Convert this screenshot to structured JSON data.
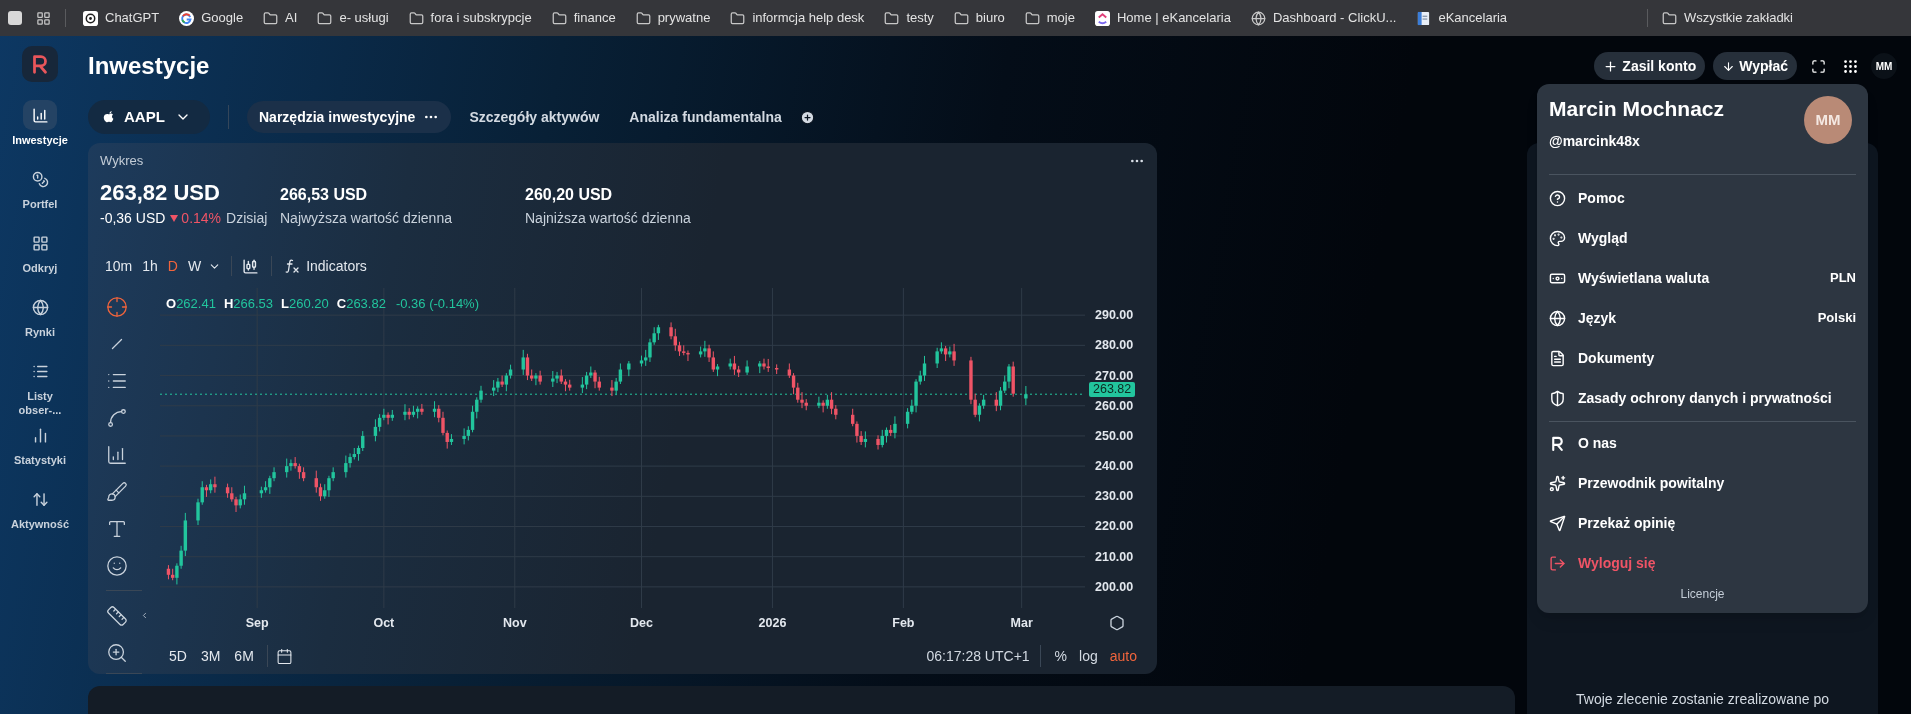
{
  "bookmarks_bar": {
    "items": [
      {
        "kind": "chatgpt",
        "label": "ChatGPT"
      },
      {
        "kind": "google",
        "label": "Google"
      },
      {
        "kind": "folder",
        "label": "AI"
      },
      {
        "kind": "folder",
        "label": "e- usługi"
      },
      {
        "kind": "folder",
        "label": "fora i subskrypcje"
      },
      {
        "kind": "folder",
        "label": "finance"
      },
      {
        "kind": "folder",
        "label": "prywatne"
      },
      {
        "kind": "folder",
        "label": "informcja help desk"
      },
      {
        "kind": "folder",
        "label": "testy"
      },
      {
        "kind": "folder",
        "label": "biuro"
      },
      {
        "kind": "folder",
        "label": "moje"
      },
      {
        "kind": "clickup",
        "label": "Home | eKancelaria"
      },
      {
        "kind": "globe",
        "label": "Dashboard - ClickU..."
      },
      {
        "kind": "document",
        "label": "eKancelaria"
      }
    ],
    "all_bookmarks": "Wszystkie zakładki"
  },
  "sidebar": {
    "items": [
      {
        "label": "Inwestycje",
        "selected": true
      },
      {
        "label": "Portfel",
        "selected": false
      },
      {
        "label": "Odkryj",
        "selected": false
      },
      {
        "label": "Rynki",
        "selected": false
      },
      {
        "label": "Listy obser-...",
        "selected": false
      },
      {
        "label": "Statystyki",
        "selected": false
      },
      {
        "label": "Aktywność",
        "selected": false
      }
    ]
  },
  "header": {
    "title": "Inwestycje",
    "buttons": [
      {
        "kind": "deposit",
        "label": "Zasil konto"
      },
      {
        "kind": "withdraw",
        "label": "Wypłać"
      }
    ],
    "avatar": "MM"
  },
  "tabs": {
    "symbol": "AAPL",
    "items": [
      {
        "label": "Narzędzia inwestycyjne",
        "selected": true
      },
      {
        "label": "Szczegóły aktywów",
        "selected": false
      },
      {
        "label": "Analiza fundamentalna",
        "selected": false
      }
    ]
  },
  "chart_card": {
    "title": "Wykres",
    "price": "263,82 USD",
    "change": "-0,36 USD",
    "change_percent": "0.14%",
    "period": "Dzisiaj",
    "stats": [
      {
        "value": "266,53 USD",
        "label": "Najwyższa wartość dzienna"
      },
      {
        "value": "260,20 USD",
        "label": "Najniższa wartość dzienna"
      }
    ],
    "timeframes": [
      {
        "label": "10m",
        "selected": false
      },
      {
        "label": "1h",
        "selected": false
      },
      {
        "label": "D",
        "selected": true
      },
      {
        "label": "W",
        "selected": false
      }
    ],
    "indicators": "Indicators",
    "legend": [
      {
        "key": "O",
        "value": "262.41"
      },
      {
        "key": "H",
        "value": "266.53"
      },
      {
        "key": "L",
        "value": "260.20"
      },
      {
        "key": "C",
        "value": "263.82"
      }
    ],
    "legend_change": "-0.36 (-0.14%)",
    "chart_data": {
      "type": "candlestick",
      "grid": true,
      "ref_lines": [
        {
          "axis": "y",
          "value": 263.82,
          "label": "263.82",
          "color": "#22c59d"
        }
      ],
      "x": [
        "2025-08-11",
        "2025-08-12",
        "2025-08-13",
        "2025-08-14",
        "2025-08-15",
        "2025-08-18",
        "2025-08-19",
        "2025-08-20",
        "2025-08-21",
        "2025-08-22",
        "2025-08-25",
        "2025-08-26",
        "2025-08-27",
        "2025-08-28",
        "2025-08-29",
        "2025-09-02",
        "2025-09-03",
        "2025-09-04",
        "2025-09-05",
        "2025-09-08",
        "2025-09-09",
        "2025-09-10",
        "2025-09-11",
        "2025-09-12",
        "2025-09-15",
        "2025-09-16",
        "2025-09-17",
        "2025-09-18",
        "2025-09-19",
        "2025-09-22",
        "2025-09-23",
        "2025-09-24",
        "2025-09-25",
        "2025-09-26",
        "2025-09-29",
        "2025-09-30",
        "2025-10-01",
        "2025-10-02",
        "2025-10-03",
        "2025-10-06",
        "2025-10-07",
        "2025-10-08",
        "2025-10-09",
        "2025-10-10",
        "2025-10-13",
        "2025-10-14",
        "2025-10-15",
        "2025-10-16",
        "2025-10-17",
        "2025-10-20",
        "2025-10-21",
        "2025-10-22",
        "2025-10-23",
        "2025-10-24",
        "2025-10-27",
        "2025-10-28",
        "2025-10-29",
        "2025-10-30",
        "2025-10-31",
        "2025-11-03",
        "2025-11-04",
        "2025-11-05",
        "2025-11-06",
        "2025-11-07",
        "2025-11-10",
        "2025-11-11",
        "2025-11-12",
        "2025-11-13",
        "2025-11-14",
        "2025-11-17",
        "2025-11-18",
        "2025-11-19",
        "2025-11-20",
        "2025-11-21",
        "2025-11-24",
        "2025-11-25",
        "2025-11-26",
        "2025-11-28",
        "2025-12-01",
        "2025-12-02",
        "2025-12-03",
        "2025-12-04",
        "2025-12-05",
        "2025-12-08",
        "2025-12-09",
        "2025-12-10",
        "2025-12-11",
        "2025-12-12",
        "2025-12-15",
        "2025-12-16",
        "2025-12-17",
        "2025-12-18",
        "2025-12-19",
        "2025-12-22",
        "2025-12-23",
        "2025-12-24",
        "2025-12-26",
        "2025-12-29",
        "2025-12-30",
        "2025-12-31",
        "2026-01-02",
        "2026-01-05",
        "2026-01-06",
        "2026-01-07",
        "2026-01-08",
        "2026-01-09",
        "2026-01-12",
        "2026-01-13",
        "2026-01-14",
        "2026-01-15",
        "2026-01-16",
        "2026-01-20",
        "2026-01-21",
        "2026-01-22",
        "2026-01-23",
        "2026-01-26",
        "2026-01-27",
        "2026-01-28",
        "2026-01-29",
        "2026-01-30",
        "2026-02-02",
        "2026-02-03",
        "2026-02-04",
        "2026-02-05",
        "2026-02-06",
        "2026-02-09",
        "2026-02-10",
        "2026-02-11",
        "2026-02-12",
        "2026-02-13",
        "2026-02-17",
        "2026-02-18",
        "2026-02-19",
        "2026-02-20",
        "2026-02-23",
        "2026-02-24",
        "2026-02-25",
        "2026-02-26",
        "2026-02-27",
        "2026-03-02"
      ],
      "ohlc": [
        [
          206,
          207.2,
          202.5,
          204
        ],
        [
          204,
          206,
          202.2,
          203
        ],
        [
          203,
          207.8,
          200.8,
          207
        ],
        [
          207,
          213.6,
          206,
          212
        ],
        [
          212,
          224.5,
          210.2,
          222
        ],
        [
          222,
          229.2,
          220.5,
          228
        ],
        [
          228,
          235,
          227.2,
          233
        ],
        [
          233,
          233.8,
          229.8,
          232
        ],
        [
          232,
          235.6,
          231,
          234
        ],
        [
          234,
          236.5,
          231.2,
          233
        ],
        [
          233,
          234.2,
          229.5,
          231
        ],
        [
          231,
          233,
          228.2,
          229
        ],
        [
          229,
          229.8,
          224.8,
          227
        ],
        [
          227,
          230.6,
          226,
          229
        ],
        [
          229,
          233.5,
          227.2,
          231
        ],
        [
          231,
          233.2,
          229.5,
          232
        ],
        [
          232,
          235,
          231.2,
          233
        ],
        [
          233,
          236.8,
          230.8,
          236
        ],
        [
          236,
          239.6,
          235,
          238
        ],
        [
          238,
          242.5,
          236.2,
          240
        ],
        [
          240,
          242.2,
          238.5,
          241
        ],
        [
          241,
          243,
          239.2,
          240
        ],
        [
          240,
          240.8,
          235.8,
          238
        ],
        [
          238,
          239.6,
          235,
          236
        ],
        [
          236,
          238.5,
          231.2,
          233
        ],
        [
          233,
          234.2,
          228.5,
          230
        ],
        [
          230,
          234,
          229.2,
          232
        ],
        [
          232,
          236.8,
          229.8,
          236
        ],
        [
          236,
          239.6,
          235,
          238
        ],
        [
          238,
          243.5,
          236.2,
          241
        ],
        [
          241,
          244.2,
          239.5,
          243
        ],
        [
          243,
          246,
          242.2,
          244
        ],
        [
          244,
          246.8,
          241.8,
          246
        ],
        [
          246,
          251.6,
          245,
          250
        ],
        [
          250,
          255.5,
          248.2,
          253
        ],
        [
          253,
          257.2,
          251.5,
          256
        ],
        [
          256,
          259,
          255.2,
          257
        ],
        [
          257,
          257.8,
          253.8,
          256
        ],
        [
          256,
          258.6,
          255,
          257
        ],
        [
          257,
          260.5,
          255.2,
          258
        ],
        [
          258,
          259.2,
          255.5,
          257
        ],
        [
          257,
          260,
          256.2,
          258
        ],
        [
          258,
          259.8,
          255.8,
          259
        ],
        [
          259,
          260.6,
          257,
          258
        ],
        [
          258,
          261.5,
          256.2,
          259
        ],
        [
          259,
          260.2,
          254.5,
          256
        ],
        [
          256,
          258,
          250.2,
          251
        ],
        [
          251,
          251.8,
          245.8,
          248
        ],
        [
          248,
          250.6,
          247,
          249
        ],
        [
          249,
          252.5,
          247.2,
          250
        ],
        [
          250,
          253.2,
          248.5,
          252
        ],
        [
          252,
          260,
          251.2,
          258
        ],
        [
          258,
          262.8,
          255.8,
          262
        ],
        [
          262,
          266.6,
          261,
          265
        ],
        [
          265,
          268.5,
          263.2,
          266
        ],
        [
          266,
          269.2,
          264.5,
          268
        ],
        [
          268,
          270,
          266.2,
          267
        ],
        [
          267,
          270.8,
          264.8,
          270
        ],
        [
          270,
          273.6,
          269,
          272
        ],
        [
          272,
          278.5,
          270.2,
          276
        ],
        [
          276,
          277.2,
          268.5,
          270
        ],
        [
          270,
          272,
          268.2,
          269
        ],
        [
          269,
          270.8,
          266.8,
          270
        ],
        [
          270,
          271.6,
          267,
          268
        ],
        [
          268,
          271.5,
          266.2,
          269
        ],
        [
          269,
          271.2,
          267.5,
          270
        ],
        [
          270,
          272,
          267.2,
          268
        ],
        [
          268,
          268.8,
          264.8,
          267
        ],
        [
          267,
          268.6,
          265,
          266
        ],
        [
          266,
          269.5,
          264.2,
          267
        ],
        [
          267,
          271.2,
          265.5,
          270
        ],
        [
          270,
          273,
          269.2,
          271
        ],
        [
          271,
          271.8,
          265.8,
          268
        ],
        [
          268,
          269.6,
          265,
          266
        ],
        [
          266,
          268.5,
          263.2,
          265
        ],
        [
          265,
          269.2,
          263.5,
          268
        ],
        [
          268,
          274,
          267.2,
          272
        ],
        [
          272,
          274.8,
          269.8,
          274
        ],
        [
          274,
          276.6,
          273,
          275
        ],
        [
          275,
          278.5,
          273.2,
          276
        ],
        [
          276,
          282.2,
          274.5,
          281
        ],
        [
          281,
          286,
          280.2,
          284
        ],
        [
          284,
          286.8,
          281.8,
          286
        ],
        [
          286,
          287.6,
          282,
          283
        ],
        [
          283,
          285.5,
          278.2,
          280
        ],
        [
          280,
          281.2,
          276.5,
          278
        ],
        [
          278,
          280,
          276.7,
          277.5
        ],
        [
          277.5,
          278.3,
          274.8,
          277
        ],
        [
          277,
          279.6,
          276,
          278
        ],
        [
          278,
          281.5,
          276.2,
          279
        ],
        [
          279,
          280.2,
          274.5,
          276
        ],
        [
          276,
          278,
          271.2,
          272
        ],
        [
          272,
          273.8,
          269.8,
          273
        ],
        [
          273,
          275.6,
          272,
          274
        ],
        [
          274,
          276.5,
          270.2,
          272
        ],
        [
          272,
          273.2,
          269.5,
          271
        ],
        [
          271,
          275,
          270.2,
          273
        ],
        [
          273,
          274.8,
          270.8,
          274
        ],
        [
          274,
          275.6,
          272,
          273
        ],
        [
          273,
          275.5,
          271.2,
          272.5
        ],
        [
          272.5,
          273.7,
          270.5,
          272
        ],
        [
          272,
          274,
          269.2,
          270
        ],
        [
          270,
          270.8,
          263.8,
          266
        ],
        [
          266,
          267.6,
          261,
          262
        ],
        [
          262,
          264.5,
          259.2,
          261
        ],
        [
          261,
          262.2,
          258.5,
          260
        ],
        [
          260,
          263,
          259.2,
          261
        ],
        [
          261,
          261.8,
          257.8,
          260
        ],
        [
          260,
          263.6,
          259,
          262
        ],
        [
          262,
          264.5,
          257.2,
          259
        ],
        [
          259,
          260.2,
          255.5,
          257
        ],
        [
          257,
          259,
          253.2,
          254
        ],
        [
          254,
          254.8,
          247.8,
          250
        ],
        [
          250,
          251.6,
          247,
          248
        ],
        [
          248,
          251.5,
          246.2,
          249
        ],
        [
          249,
          250.2,
          245.5,
          247
        ],
        [
          247,
          252,
          246.2,
          250
        ],
        [
          250,
          252.8,
          247.8,
          252
        ],
        [
          252,
          253.6,
          250,
          251
        ],
        [
          251,
          256.5,
          249.2,
          254
        ],
        [
          254,
          259.2,
          252.5,
          258
        ],
        [
          258,
          262,
          257.2,
          260
        ],
        [
          260,
          268.8,
          257.8,
          268
        ],
        [
          268,
          271.6,
          267,
          270
        ],
        [
          270,
          276.5,
          268.2,
          274
        ],
        [
          274,
          279.2,
          272.5,
          278
        ],
        [
          278,
          281,
          277.2,
          279
        ],
        [
          279,
          279.8,
          274.8,
          277
        ],
        [
          277,
          279.6,
          276,
          278
        ],
        [
          278,
          280.5,
          273.2,
          275
        ],
        [
          275,
          276.2,
          260.5,
          262
        ],
        [
          262,
          264,
          256.2,
          257
        ],
        [
          257,
          260.8,
          254.8,
          260
        ],
        [
          260,
          263.6,
          259,
          262
        ],
        [
          262,
          264.5,
          258.2,
          260
        ],
        [
          260,
          266.2,
          258.5,
          265
        ],
        [
          265,
          270,
          264.2,
          268
        ],
        [
          268,
          273.8,
          265.8,
          273
        ],
        [
          273,
          274.6,
          263,
          264
        ],
        [
          262.41,
          266.53,
          260.2,
          263.82
        ]
      ],
      "ylim": [
        193,
        299
      ],
      "yticks": [
        {
          "value": 290,
          "label": "290.00"
        },
        {
          "value": 280,
          "label": "280.00"
        },
        {
          "value": 270,
          "label": "270.00"
        },
        {
          "value": 260,
          "label": "260.00"
        },
        {
          "value": 250,
          "label": "250.00"
        },
        {
          "value": 240,
          "label": "240.00"
        },
        {
          "value": 230,
          "label": "230.00"
        },
        {
          "value": 220,
          "label": "220.00"
        },
        {
          "value": 210,
          "label": "210.00"
        },
        {
          "value": 200,
          "label": "200.00"
        }
      ],
      "xlim": [
        "2025-08-09",
        "2026-03-16"
      ],
      "xticks": [
        {
          "value": "2025-09-01",
          "label": "Sep"
        },
        {
          "value": "2025-10-01",
          "label": "Oct"
        },
        {
          "value": "2025-11-01",
          "label": "Nov"
        },
        {
          "value": "2025-12-01",
          "label": "Dec"
        },
        {
          "value": "2026-01-01",
          "label": "2026"
        },
        {
          "value": "2026-02-01",
          "label": "Feb"
        },
        {
          "value": "2026-03-01",
          "label": "Mar"
        }
      ]
    },
    "ranges": [
      "5D",
      "3M",
      "6M"
    ],
    "time": "06:17:28 UTC+1",
    "scale_options": [
      {
        "label": "%",
        "selected": false
      },
      {
        "label": "log",
        "selected": false
      },
      {
        "label": "auto",
        "selected": true
      }
    ]
  },
  "order_panel": {
    "note": "Twoje zlecenie zostanie zrealizowane po"
  },
  "account_menu": {
    "name": "Marcin Mochnacz",
    "handle": "@marcink48x",
    "avatar": "MM",
    "groups": [
      {
        "items": [
          {
            "label": "Pomoc",
            "kind": "normal"
          },
          {
            "label": "Wygląd",
            "kind": "normal"
          },
          {
            "label": "Wyświetlana waluta",
            "value": "PLN",
            "kind": "normal"
          },
          {
            "label": "Język",
            "value": "Polski",
            "kind": "normal"
          },
          {
            "label": "Dokumenty",
            "kind": "normal"
          },
          {
            "label": "Zasady ochrony danych i prywatności",
            "kind": "normal"
          }
        ]
      },
      {
        "items": [
          {
            "label": "O nas",
            "kind": "normal"
          },
          {
            "label": "Przewodnik powitalny",
            "kind": "normal"
          },
          {
            "label": "Przekaż opinię",
            "kind": "normal"
          },
          {
            "label": "Wyloguj się",
            "kind": "danger"
          }
        ]
      }
    ],
    "footer": "Licencje"
  }
}
